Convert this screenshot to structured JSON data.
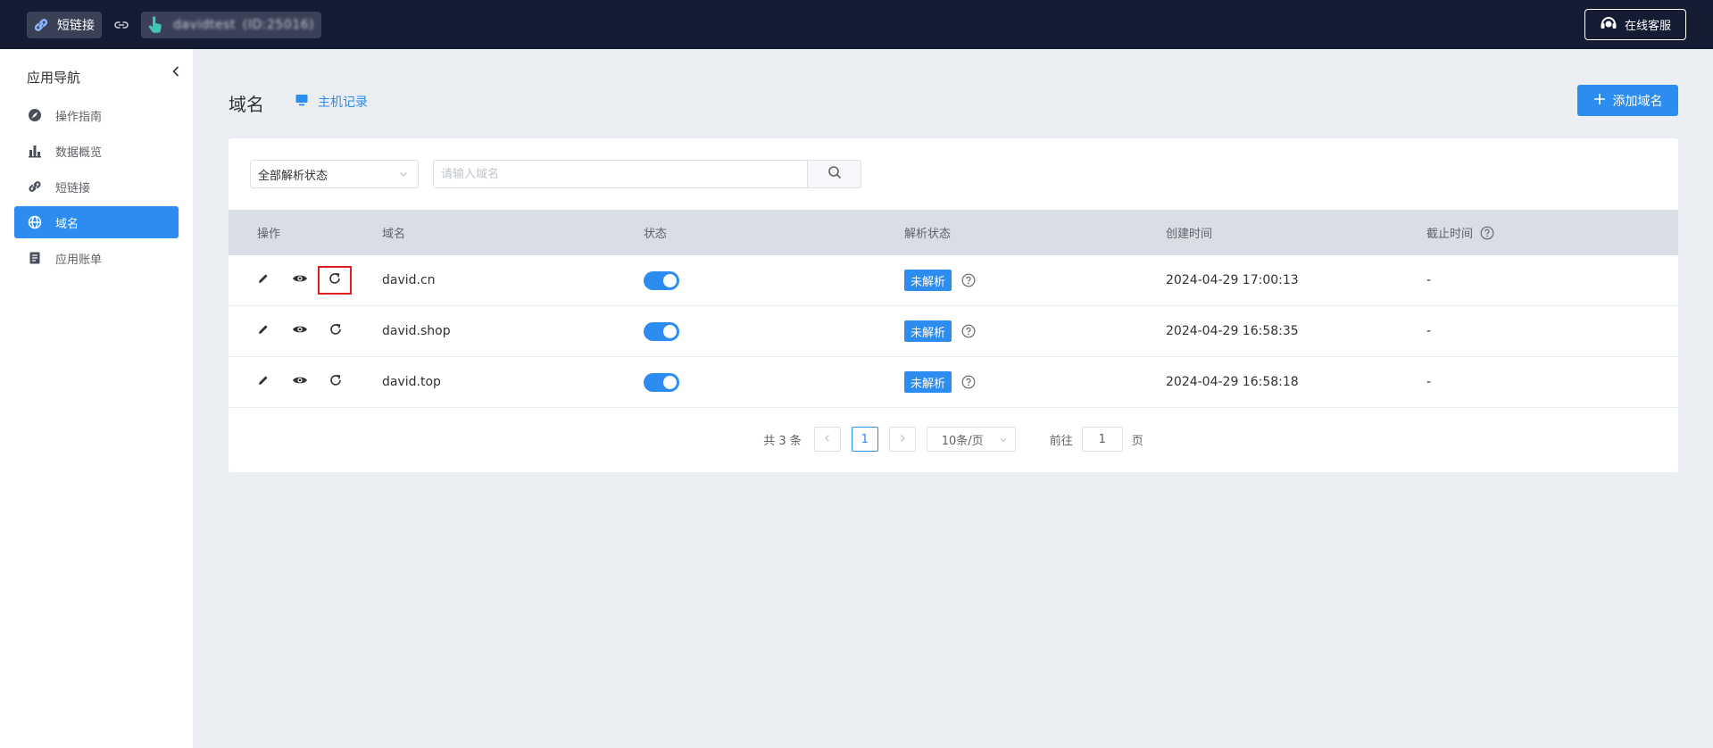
{
  "topbar": {
    "app_name": "短链接",
    "username": "davidtest",
    "user_id": "(ID:25016)",
    "service_label": "在线客服"
  },
  "sidebar": {
    "title": "应用导航",
    "items": [
      {
        "label": "操作指南",
        "icon": "compass-icon"
      },
      {
        "label": "数据概览",
        "icon": "bar-chart-icon"
      },
      {
        "label": "短链接",
        "icon": "link-icon"
      },
      {
        "label": "域名",
        "icon": "globe-icon",
        "active": true
      },
      {
        "label": "应用账单",
        "icon": "bill-icon"
      }
    ]
  },
  "main": {
    "title": "域名",
    "host_link": "主机记录",
    "add_button": "添加域名",
    "filter": {
      "status_select": "全部解析状态",
      "search_placeholder": "请输入域名"
    },
    "table": {
      "headers": {
        "op": "操作",
        "domain": "域名",
        "status": "状态",
        "parse_status": "解析状态",
        "created": "创建时间",
        "expires": "截止时间"
      },
      "rows": [
        {
          "domain": "david.cn",
          "enabled": true,
          "parse_status": "未解析",
          "created": "2024-04-29 17:00:13",
          "expires": "-"
        },
        {
          "domain": "david.shop",
          "enabled": true,
          "parse_status": "未解析",
          "created": "2024-04-29 16:58:35",
          "expires": "-"
        },
        {
          "domain": "david.top",
          "enabled": true,
          "parse_status": "未解析",
          "created": "2024-04-29 16:58:18",
          "expires": "-"
        }
      ]
    },
    "pagination": {
      "total": "共 3 条",
      "current_page": "1",
      "page_size": "10条/页",
      "goto_label": "前往",
      "goto_value": "1",
      "page_suffix": "页"
    }
  },
  "colors": {
    "topbar_bg": "#141c33",
    "primary": "#2d8cf0",
    "page_bg": "#ebeef3",
    "header_row_bg": "#d9dde6",
    "highlight_border": "#e02020"
  }
}
